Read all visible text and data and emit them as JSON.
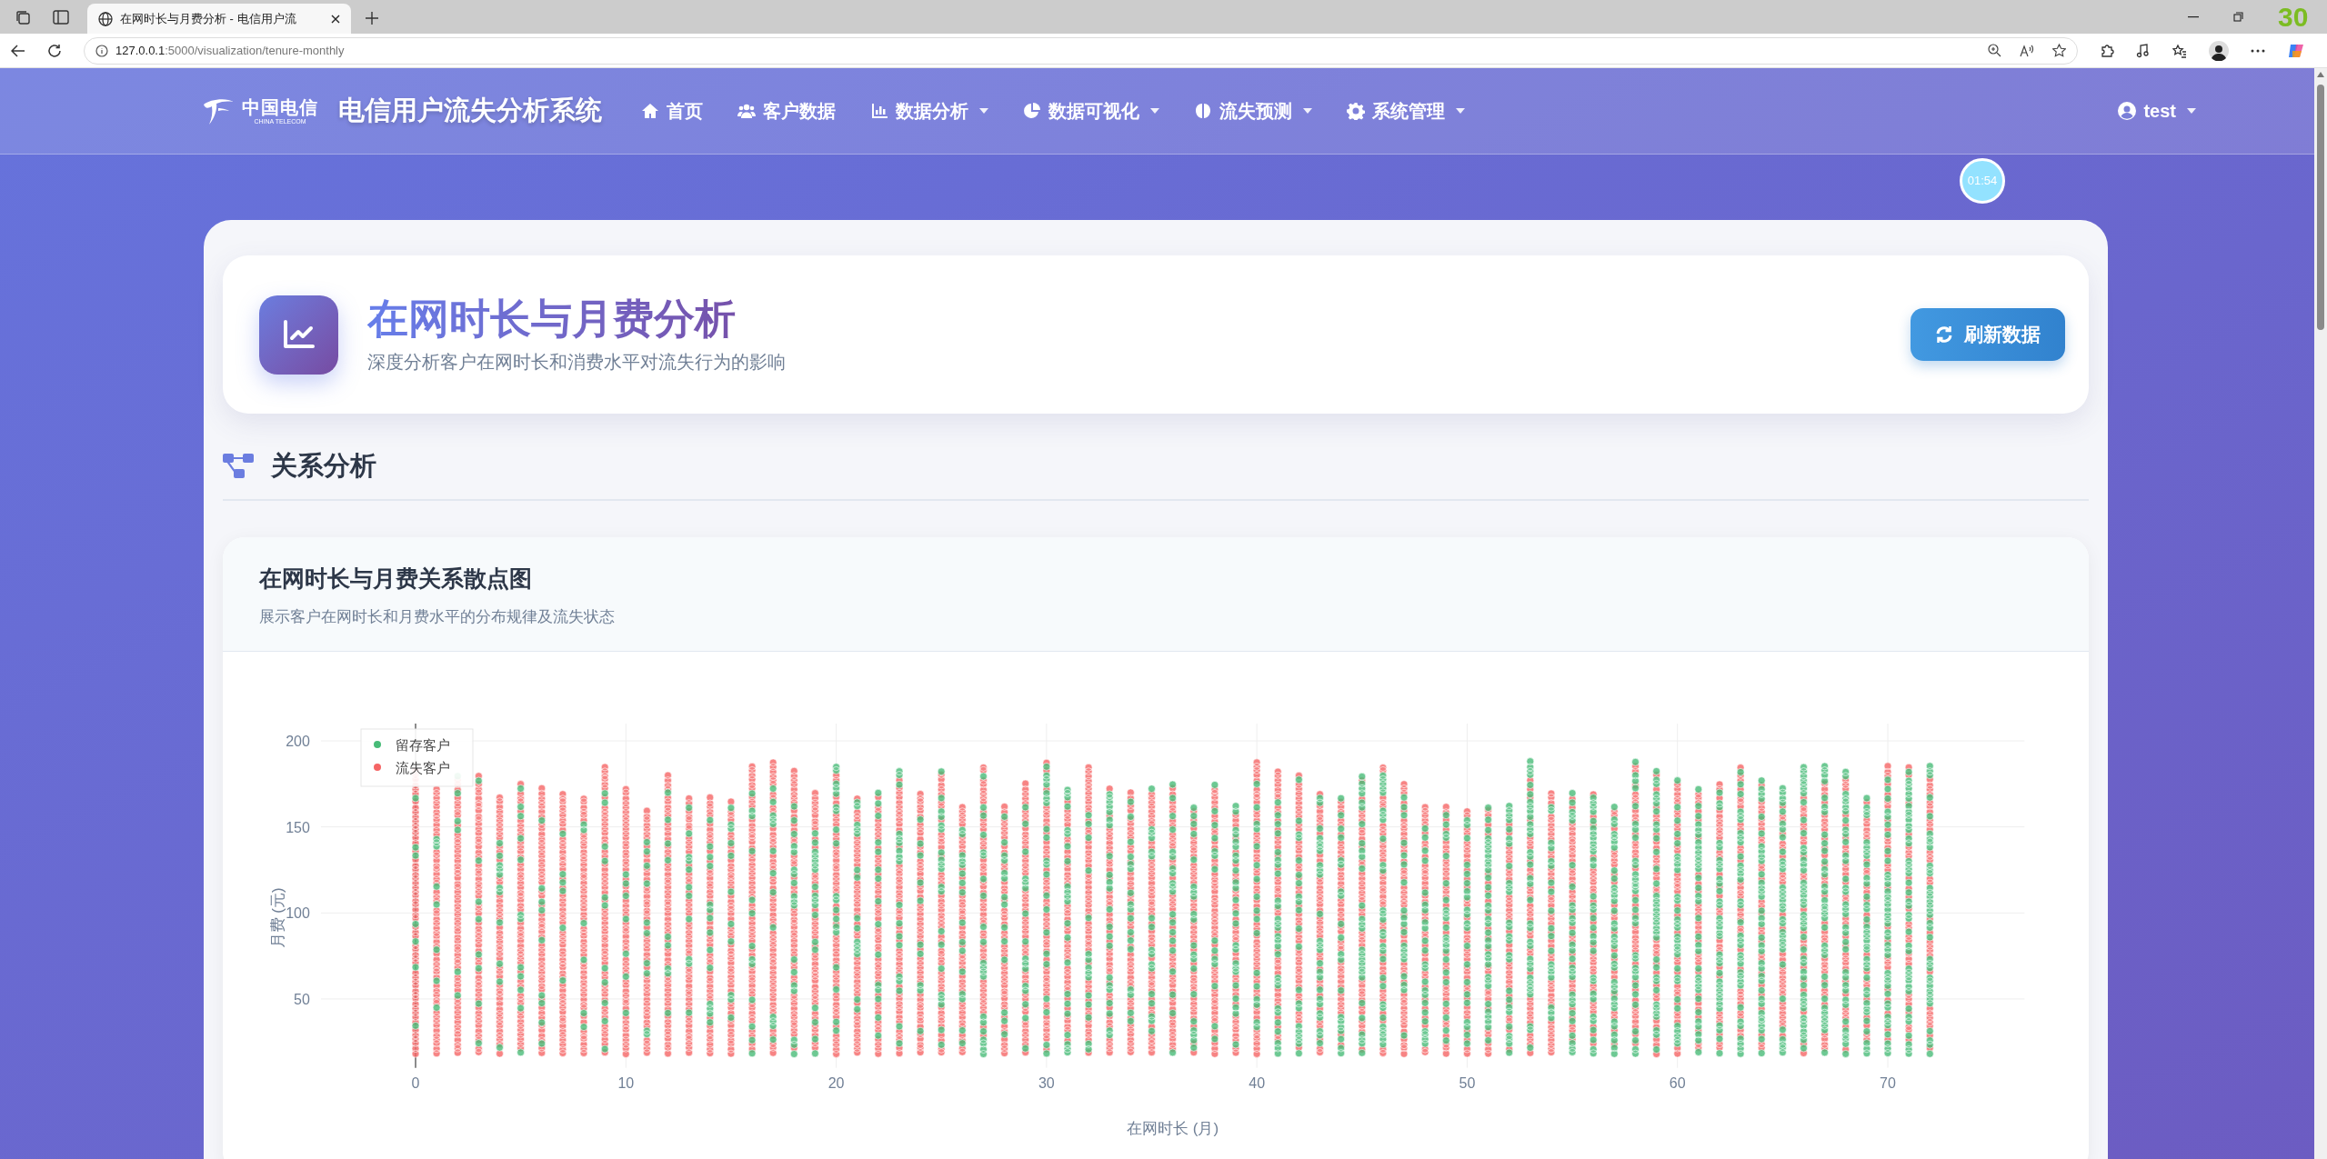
{
  "browser": {
    "tab_title": "在网时长与月费分析 - 电信用户流",
    "url_host": "127.0.0.1",
    "url_path": ":5000/visualization/tenure-monthly",
    "overlay_counter": "30"
  },
  "navbar": {
    "logo_cn": "中国电信",
    "logo_en": "CHINA TELECOM",
    "brand": "电信用户流失分析系统",
    "items": [
      {
        "label": "首页",
        "dropdown": false
      },
      {
        "label": "客户数据",
        "dropdown": false
      },
      {
        "label": "数据分析",
        "dropdown": true
      },
      {
        "label": "数据可视化",
        "dropdown": true
      },
      {
        "label": "流失预测",
        "dropdown": true
      },
      {
        "label": "系统管理",
        "dropdown": true
      }
    ],
    "user": {
      "label": "test",
      "dropdown": true
    }
  },
  "timer": "01:54",
  "header": {
    "title": "在网时长与月费分析",
    "subtitle": "深度分析客户在网时长和消费水平对流失行为的影响",
    "refresh_button": "刷新数据"
  },
  "section": {
    "title": "关系分析"
  },
  "chart_card": {
    "title": "在网时长与月费关系散点图",
    "subtitle": "展示客户在网时长和月费水平的分布规律及流失状态",
    "scatter_plot": {
      "kind": "picture",
      "x_axis_title": "在网时长 (月)",
      "y_axis_title": "月费 (元)",
      "x_tick_labels": [
        "0",
        "10",
        "20",
        "30",
        "40",
        "50",
        "60",
        "70"
      ],
      "y_tick_labels": [
        "200",
        "150",
        "100",
        "50"
      ],
      "legend": [
        {
          "label": "留存客户",
          "color": "#48bb78"
        },
        {
          "label": "流失客户",
          "color": "#f56565"
        }
      ]
    }
  }
}
